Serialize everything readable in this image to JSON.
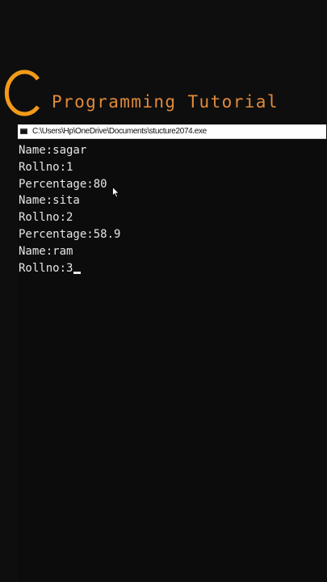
{
  "brand": {
    "logo_letter": "C",
    "title": "Programming Tutorial",
    "logo_color": "#f29a1a",
    "title_color": "#e08a3c"
  },
  "window": {
    "icon": "console-app-icon",
    "title": "C:\\Users\\Hp\\OneDrive\\Documents\\stucture2074.exe"
  },
  "console": {
    "lines": [
      "Name:sagar",
      "Rollno:1",
      "Percentage:80",
      "Name:sita",
      "Rollno:2",
      "Percentage:58.9",
      "Name:ram",
      "Rollno:3"
    ],
    "text_color": "#e6e6e6",
    "background": "#0c0c0c"
  },
  "pointer": {
    "icon": "mouse-pointer-icon"
  }
}
